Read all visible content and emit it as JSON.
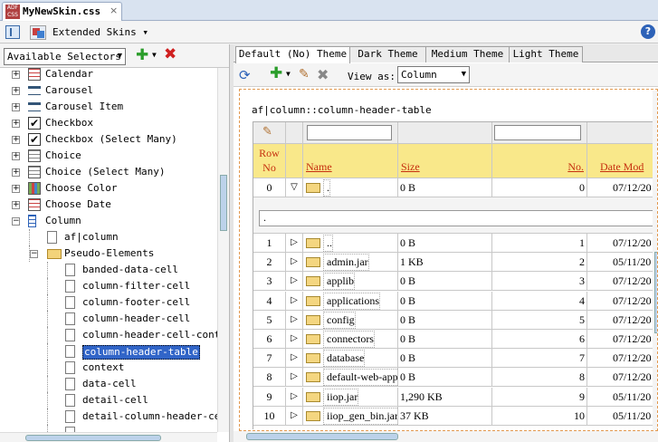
{
  "editor_tab": {
    "filename": "MyNewSkin.css",
    "icon_label": "ADF CSS",
    "close": "×"
  },
  "toolbar": {
    "skin_label": "Extended Skins",
    "help": "?"
  },
  "selectors": {
    "dropdown_value": "Available Selectors"
  },
  "tree": [
    {
      "label": "Calendar",
      "indent": 0,
      "expander": "+",
      "icon": "grid"
    },
    {
      "label": "Carousel",
      "indent": 0,
      "expander": "+",
      "icon": "carousel"
    },
    {
      "label": "Carousel Item",
      "indent": 0,
      "expander": "+",
      "icon": "carousel"
    },
    {
      "label": "Checkbox",
      "indent": 0,
      "expander": "+",
      "icon": "check"
    },
    {
      "label": "Checkbox (Select Many)",
      "indent": 0,
      "expander": "+",
      "icon": "check"
    },
    {
      "label": "Choice",
      "indent": 0,
      "expander": "+",
      "icon": "choice"
    },
    {
      "label": "Choice (Select Many)",
      "indent": 0,
      "expander": "+",
      "icon": "choice"
    },
    {
      "label": "Choose Color",
      "indent": 0,
      "expander": "+",
      "icon": "color"
    },
    {
      "label": "Choose Date",
      "indent": 0,
      "expander": "+",
      "icon": "grid"
    },
    {
      "label": "Column",
      "indent": 0,
      "expander": "−",
      "icon": "column"
    },
    {
      "label": "af|column",
      "indent": 1,
      "expander": "",
      "icon": "page"
    },
    {
      "label": "Pseudo-Elements",
      "indent": 1,
      "expander": "−",
      "icon": "folder"
    },
    {
      "label": "banded-data-cell",
      "indent": 2,
      "expander": "",
      "icon": "page"
    },
    {
      "label": "column-filter-cell",
      "indent": 2,
      "expander": "",
      "icon": "page"
    },
    {
      "label": "column-footer-cell",
      "indent": 2,
      "expander": "",
      "icon": "page"
    },
    {
      "label": "column-header-cell",
      "indent": 2,
      "expander": "",
      "icon": "page"
    },
    {
      "label": "column-header-cell-content",
      "indent": 2,
      "expander": "",
      "icon": "page"
    },
    {
      "label": "column-header-table",
      "indent": 2,
      "expander": "",
      "icon": "page",
      "selected": true
    },
    {
      "label": "context",
      "indent": 2,
      "expander": "",
      "icon": "page"
    },
    {
      "label": "data-cell",
      "indent": 2,
      "expander": "",
      "icon": "page"
    },
    {
      "label": "detail-cell",
      "indent": 2,
      "expander": "",
      "icon": "page"
    },
    {
      "label": "detail-column-header-cell",
      "indent": 2,
      "expander": "",
      "icon": "page"
    },
    {
      "label": "",
      "indent": 2,
      "expander": "",
      "icon": "page"
    }
  ],
  "theme_tabs": [
    "Default (No) Theme",
    "Dark Theme",
    "Medium Theme",
    "Light Theme"
  ],
  "preview_toolbar": {
    "view_as_label": "View as:",
    "view_as_value": "Column"
  },
  "preview": {
    "selector_label": "af|column::column-header-table",
    "headers": {
      "row_no": "Row No",
      "row_line1": "Row",
      "row_line2": "No",
      "name": "Name",
      "size": "Size",
      "no": "No.",
      "date": "Date Mod"
    },
    "first_row": {
      "row": "0",
      "toggle": "▽",
      "name": ".",
      "size": "0 B",
      "no": "0",
      "date": "07/12/20"
    },
    "path_field": ".",
    "rows": [
      {
        "row": "1",
        "name": "..",
        "size": "0 B",
        "no": "1",
        "date": "07/12/20"
      },
      {
        "row": "2",
        "name": "admin.jar",
        "size": "1 KB",
        "no": "2",
        "date": "05/11/20"
      },
      {
        "row": "3",
        "name": "applib",
        "size": "0 B",
        "no": "3",
        "date": "07/12/20"
      },
      {
        "row": "4",
        "name": "applications",
        "size": "0 B",
        "no": "4",
        "date": "07/12/20"
      },
      {
        "row": "5",
        "name": "config",
        "size": "0 B",
        "no": "5",
        "date": "07/12/20"
      },
      {
        "row": "6",
        "name": "connectors",
        "size": "0 B",
        "no": "6",
        "date": "07/12/20"
      },
      {
        "row": "7",
        "name": "database",
        "size": "0 B",
        "no": "7",
        "date": "07/12/20"
      },
      {
        "row": "8",
        "name": "default-web-app",
        "size": "0 B",
        "no": "8",
        "date": "07/12/20"
      },
      {
        "row": "9",
        "name": "iiop.jar",
        "size": "1,290 KB",
        "no": "9",
        "date": "05/11/20"
      },
      {
        "row": "10",
        "name": "iiop_gen_bin.jar",
        "size": "37 KB",
        "no": "10",
        "date": "05/11/20"
      }
    ],
    "row_toggle": "▷"
  }
}
